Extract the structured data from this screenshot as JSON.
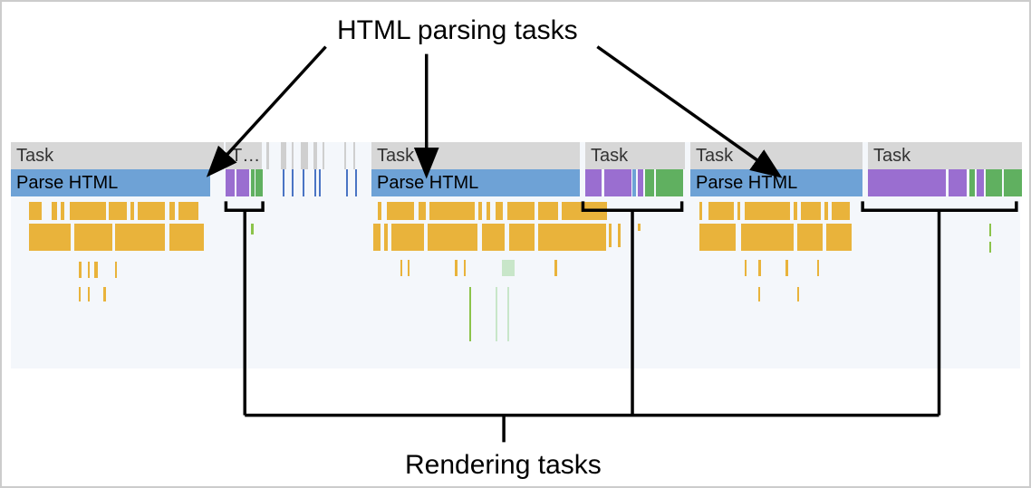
{
  "labels": {
    "top": "HTML parsing tasks",
    "bottom": "Rendering tasks"
  },
  "task_row": {
    "t1": "Task",
    "t2": "T…",
    "t3": "Task",
    "t4": "Task",
    "t5": "Task",
    "t6": "Task"
  },
  "parse": {
    "p1": "Parse HTML",
    "p2": "Parse HTML",
    "p3": "Parse HTML"
  }
}
